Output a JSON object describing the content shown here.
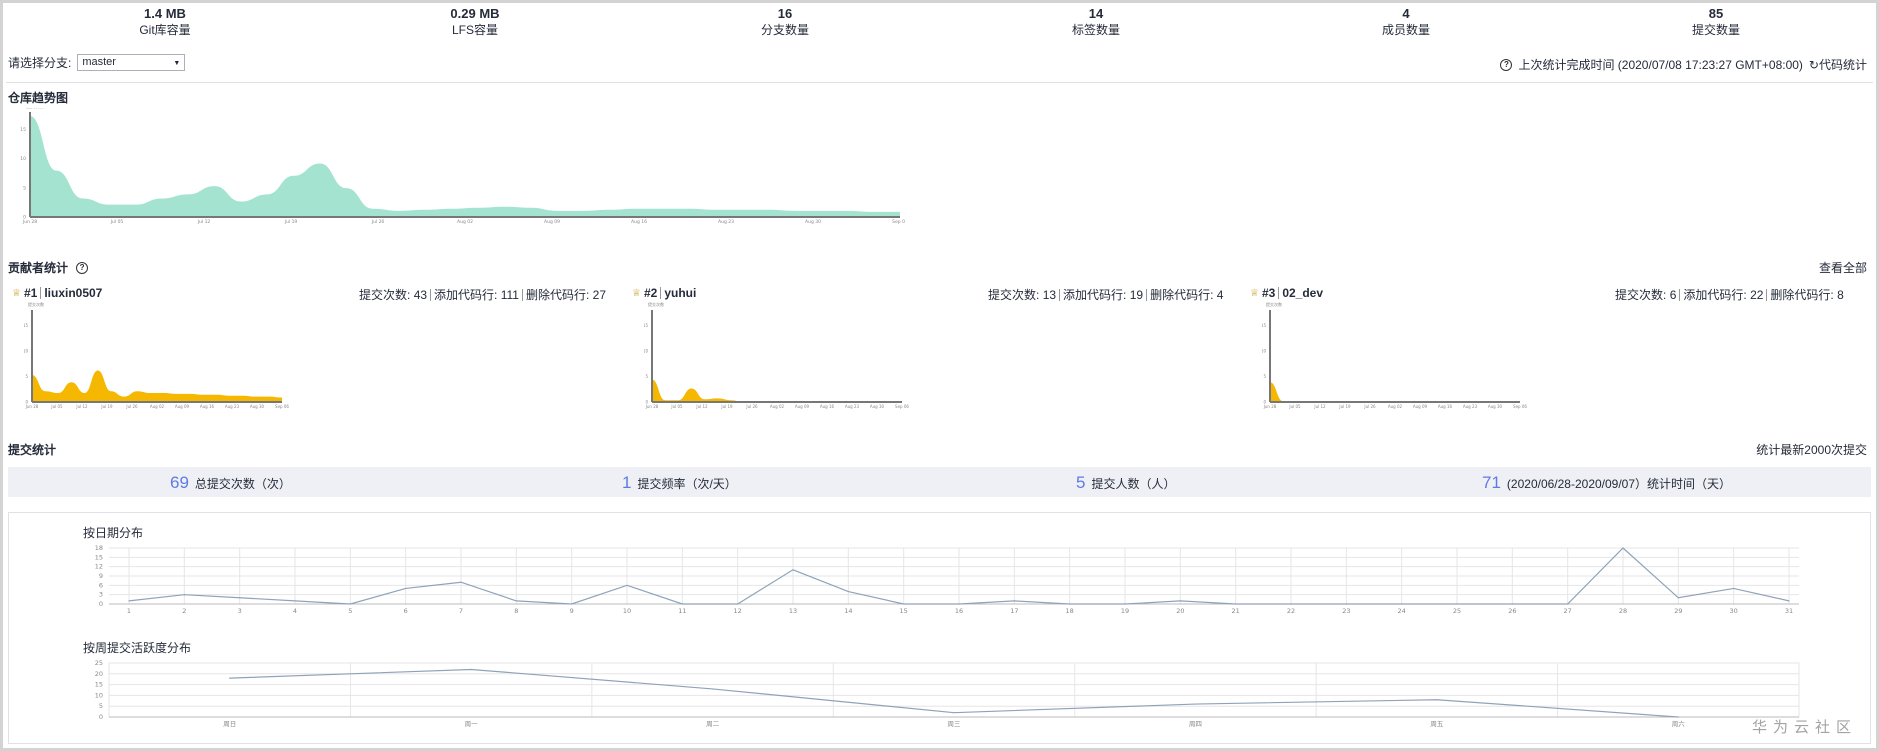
{
  "summary_stats": [
    {
      "value": "1.4 MB",
      "label": "Git库容量"
    },
    {
      "value": "0.29 MB",
      "label": "LFS容量"
    },
    {
      "value": "16",
      "label": "分支数量"
    },
    {
      "value": "14",
      "label": "标签数量"
    },
    {
      "value": "4",
      "label": "成员数量"
    },
    {
      "value": "85",
      "label": "提交数量"
    }
  ],
  "branch": {
    "label": "请选择分支:",
    "selected": "master"
  },
  "stat_time": {
    "text": "上次统计完成时间 (2020/07/08 17:23:27 GMT+08:00)",
    "refresh_label": "代码统计"
  },
  "repo_trend": {
    "title": "仓库趋势图",
    "y_title": "提交次数",
    "y_ticks": [
      "0",
      "5",
      "10",
      "15"
    ],
    "x_ticks": [
      "Jun 28",
      "Jul 05",
      "Jul 12",
      "Jul 19",
      "Jul 26",
      "Aug 02",
      "Aug 09",
      "Aug 16",
      "Aug 23",
      "Aug 30",
      "Sep 06"
    ],
    "color": "#a4e3cf"
  },
  "contributors": {
    "title": "贡献者统计",
    "view_all": "查看全部",
    "commits_label": "提交次数:",
    "added_label": "添加代码行:",
    "deleted_label": "删除代码行:",
    "color": "#f5b700",
    "items": [
      {
        "rank": "#1",
        "name": "liuxin0507",
        "commits": "43",
        "added": "111",
        "deleted": "27"
      },
      {
        "rank": "#2",
        "name": "yuhui",
        "commits": "13",
        "added": "19",
        "deleted": "4"
      },
      {
        "rank": "#3",
        "name": "02_dev",
        "commits": "6",
        "added": "22",
        "deleted": "8"
      }
    ],
    "mini_y_ticks": [
      "0",
      "5",
      "10",
      "15"
    ],
    "mini_x_ticks": [
      "Jun 28",
      "Jul 05",
      "Jul 12",
      "Jul 19",
      "Jul 26",
      "Aug 02",
      "Aug 09",
      "Aug 16",
      "Aug 23",
      "Aug 30",
      "Sep 06"
    ]
  },
  "commit_stats": {
    "title": "提交统计",
    "note": "统计最新2000次提交",
    "items": [
      {
        "num": "69",
        "label": "总提交次数（次）"
      },
      {
        "num": "1",
        "label": "提交频率（次/天）"
      },
      {
        "num": "5",
        "label": "提交人数（人）"
      },
      {
        "num": "71",
        "label": "(2020/06/28-2020/09/07）统计时间（天）"
      }
    ]
  },
  "chart_data": [
    {
      "type": "line",
      "title": "按日期分布",
      "x": [
        "1",
        "2",
        "3",
        "4",
        "5",
        "6",
        "7",
        "8",
        "9",
        "10",
        "11",
        "12",
        "13",
        "14",
        "15",
        "16",
        "17",
        "18",
        "19",
        "20",
        "21",
        "22",
        "23",
        "24",
        "25",
        "26",
        "27",
        "28",
        "29",
        "30",
        "31"
      ],
      "values": [
        1,
        3,
        2,
        1,
        0,
        5,
        7,
        1,
        0,
        6,
        0,
        0,
        11,
        4,
        0,
        0,
        1,
        0,
        0,
        1,
        0,
        0,
        0,
        0,
        0,
        0,
        0,
        18,
        2,
        5,
        1
      ],
      "yticks": [
        "0",
        "3",
        "6",
        "9",
        "12",
        "15",
        "18"
      ],
      "ylim": [
        0,
        18
      ],
      "color": "#8fa3b8"
    },
    {
      "type": "line",
      "title": "按周提交活跃度分布",
      "x": [
        "周日",
        "周一",
        "周二",
        "周三",
        "周四",
        "周五",
        "周六"
      ],
      "values": [
        18,
        22,
        13,
        2,
        6,
        8,
        0
      ],
      "yticks": [
        "0",
        "5",
        "10",
        "15",
        "20",
        "25"
      ],
      "ylim": [
        0,
        25
      ],
      "color": "#8fa3b8"
    }
  ],
  "watermark": "华为云社区"
}
